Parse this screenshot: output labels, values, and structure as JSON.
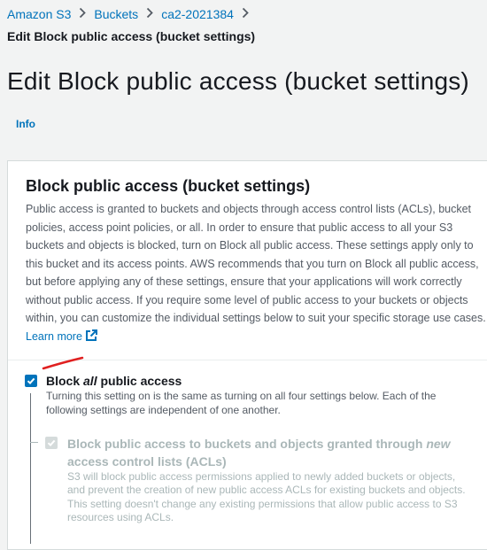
{
  "breadcrumb": {
    "items": [
      "Amazon S3",
      "Buckets",
      "ca2-2021384"
    ],
    "current": "Edit Block public access (bucket settings)"
  },
  "page": {
    "title": "Edit Block public access (bucket settings)",
    "info_link": "Info"
  },
  "panel": {
    "title": "Block public access (bucket settings)",
    "description": "Public access is granted to buckets and objects through access control lists (ACLs), bucket policies, access point policies, or all. In order to ensure that public access to all your S3 buckets and objects is blocked, turn on Block all public access. These settings apply only to this bucket and its access points. AWS recommends that you turn on Block all public access, but before applying any of these settings, ensure that your applications will work correctly without public access. If you require some level of public access to your buckets or objects within, you can customize the individual settings below to suit your specific storage use cases.",
    "learn_more": "Learn more"
  },
  "options": {
    "block_all": {
      "label_prefix": "Block ",
      "label_emphasis": "all",
      "label_suffix": " public access",
      "checked": true,
      "description": "Turning this setting on is the same as turning on all four settings below. Each of the following settings are independent of one another."
    },
    "new_acls": {
      "label_prefix": "Block public access to buckets and objects granted through ",
      "label_emphasis": "new",
      "label_suffix": " access control lists (ACLs)",
      "checked": true,
      "disabled": true,
      "description": "S3 will block public access permissions applied to newly added buckets or objects, and prevent the creation of new public access ACLs for existing buckets and objects. This setting doesn't change any existing permissions that allow public access to S3 resources using ACLs."
    }
  },
  "colors": {
    "link": "#0073bb",
    "annotation": "#e02020",
    "disabled": "#aab7b8"
  },
  "icons": {
    "breadcrumb_separator": "chevron-right-icon",
    "external_link": "external-link-icon",
    "checkbox": "check-icon"
  }
}
